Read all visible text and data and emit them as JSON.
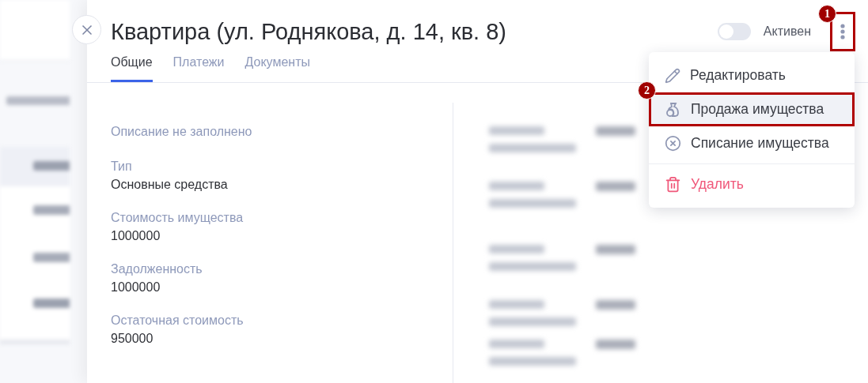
{
  "title": "Квартира (ул. Роднякова, д. 14, кв. 8)",
  "status_toggle": {
    "label": "Активен",
    "on": false
  },
  "more_button": {
    "annotation": "1"
  },
  "tabs": [
    {
      "label": "Общие",
      "selected": true
    },
    {
      "label": "Платежи",
      "selected": false
    },
    {
      "label": "Документы",
      "selected": false
    }
  ],
  "description": "Описание не заполнено",
  "fields": [
    {
      "label": "Тип",
      "value": "Основные средства"
    },
    {
      "label": "Стоимость имущества",
      "value": "1000000"
    },
    {
      "label": "Задолженность",
      "value": "1000000"
    },
    {
      "label": "Остаточная стоимость",
      "value": "950000"
    }
  ],
  "menu": {
    "items": [
      {
        "kind": "edit",
        "label": "Редактировать",
        "highlighted": false
      },
      {
        "kind": "sale",
        "label": "Продажа имущества",
        "highlighted": true,
        "annotation": "2"
      },
      {
        "kind": "writeoff",
        "label": "Списание имущества",
        "highlighted": false
      },
      {
        "kind": "delete",
        "label": "Удалить",
        "highlighted": false
      }
    ]
  }
}
